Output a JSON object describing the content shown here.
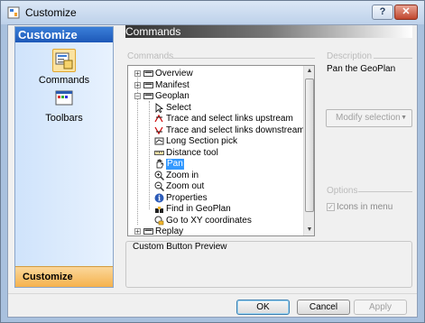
{
  "window": {
    "title": "Customize",
    "help_label": "?",
    "close_label": "✕"
  },
  "nav": {
    "header": "Customize",
    "items": [
      {
        "label": "Commands",
        "icon": "commands-icon",
        "selected": true
      },
      {
        "label": "Toolbars",
        "icon": "toolbars-icon",
        "selected": false
      }
    ],
    "footer": "Customize"
  },
  "panel": {
    "header": "Commands",
    "commands_group": "Commands",
    "description_group": "Description",
    "description_text": "Pan the GeoPlan",
    "modify_selection": "Modify selection",
    "options_group": "Options",
    "icons_in_menu": "Icons in menu",
    "icons_in_menu_checked": true,
    "preview_label": "Custom Button Preview"
  },
  "tree": {
    "rows": [
      {
        "label": "Overview",
        "level": 0,
        "expander": "+",
        "icon": "toolbar-icon"
      },
      {
        "label": "Manifest",
        "level": 0,
        "expander": "+",
        "icon": "toolbar-icon"
      },
      {
        "label": "Geoplan",
        "level": 0,
        "expander": "−",
        "icon": "toolbar-icon"
      },
      {
        "label": "Select",
        "level": 1,
        "icon": "arrow-cursor-icon"
      },
      {
        "label": "Trace and select links upstream",
        "level": 1,
        "icon": "trace-upstream-icon"
      },
      {
        "label": "Trace and select links downstream",
        "level": 1,
        "icon": "trace-downstream-icon"
      },
      {
        "label": "Long Section pick",
        "level": 1,
        "icon": "long-section-icon"
      },
      {
        "label": "Distance tool",
        "level": 1,
        "icon": "ruler-icon"
      },
      {
        "label": "Pan",
        "level": 1,
        "icon": "hand-icon",
        "selected": true
      },
      {
        "label": "Zoom in",
        "level": 1,
        "icon": "zoom-in-icon"
      },
      {
        "label": "Zoom out",
        "level": 1,
        "icon": "zoom-out-icon"
      },
      {
        "label": "Properties",
        "level": 1,
        "icon": "properties-icon"
      },
      {
        "label": "Find in GeoPlan",
        "level": 1,
        "icon": "find-icon"
      },
      {
        "label": "Go to XY coordinates",
        "level": 1,
        "icon": "goto-xy-icon"
      },
      {
        "label": "Replay",
        "level": 0,
        "expander": "+",
        "icon": "toolbar-icon"
      }
    ]
  },
  "buttons": {
    "ok": "OK",
    "cancel": "Cancel",
    "apply": "Apply"
  },
  "colors": {
    "selection": "#3399ff",
    "nav_header": "#1d58b8",
    "nav_footer": "#f5b24d"
  }
}
